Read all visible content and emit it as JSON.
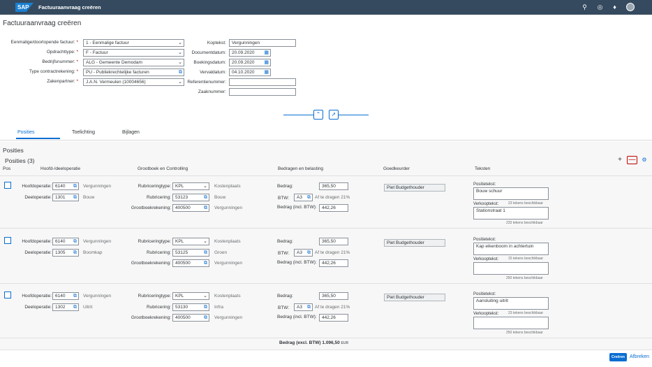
{
  "shell": {
    "logo": "SAP",
    "title": "Factuuraanvraag creëren"
  },
  "page": {
    "title": "Factuuraanvraag creëren"
  },
  "header": {
    "eenmalig_label": "Eenmalige/doorlopende factuur:",
    "eenmalig_value": "1 - Eenmalige factuur",
    "opdrachttype_label": "Opdrachttype:",
    "opdrachttype_value": "F - Factuur",
    "bedrijfsnummer_label": "Bedrijfsnummer:",
    "bedrijfsnummer_value": "ALG - Gemeente Demodam",
    "contract_label": "Type contractrekening:",
    "contract_value": "PU - Publiekrechtelijke facturen",
    "zakenpartner_label": "Zakenpartner:",
    "zakenpartner_value": "J.A.N. Vermeulen (10004656)",
    "koptekst_label": "Koptekst:",
    "koptekst_value": "Vergunningen",
    "documentdatum_label": "Documentdatum:",
    "documentdatum_value": "20.09.2020",
    "boekingsdatum_label": "Boekingsdatum:",
    "boekingsdatum_value": "20.09.2020",
    "vervaldatum_label": "Vervaldatum:",
    "vervaldatum_value": "04.10.2020",
    "referentie_label": "Referentienummer:",
    "referentie_value": "",
    "zaak_label": "Zaaknummer:",
    "zaak_value": ""
  },
  "tabs": [
    "Posities",
    "Toelichting",
    "Bijlagen"
  ],
  "section": {
    "title": "Posities",
    "table_title": "Posities (3)"
  },
  "columns": {
    "pos": "Pos",
    "hoofd": "Hoofd-/deeloperatie",
    "grootboek": "Grootboek en Controlling",
    "bedragen": "Bedragen en belasting",
    "goedkeurder": "Goedkeurder",
    "teksten": "Teksten"
  },
  "labels": {
    "hoofdoperatie": "Hoofdoperatie:",
    "deeloperatie": "Deeloperatie:",
    "rubriceringtype": "Rubriceringtype:",
    "rubricering": "Rubricering:",
    "grootboekrekening": "Grootboekrekening:",
    "bedrag": "Bedrag:",
    "btw": "BTW:",
    "bedrag_incl": "Bedrag (incl. BTW):",
    "positietekst": "Positietekst:",
    "verkooptekst": "Verkooptekst:"
  },
  "rows": [
    {
      "hoofd_code": "6140",
      "hoofd_text": "Vergunningen",
      "deel_code": "1301",
      "deel_text": "Bouw",
      "rubtype": "KPL",
      "rubtype_text": "Kostenplaats",
      "rub": "53123",
      "rub_text": "Bouw",
      "gb": "400500",
      "gb_text": "Vergunningen",
      "bedrag": "365,50",
      "btw": "A3",
      "btw_text": "Af te dragen 21%",
      "incl": "442,26",
      "goedkeurder": "Piet Budgethouder",
      "positietekst": "Bouw schuur",
      "pos_count": "23 tekens beschikbaar",
      "verkooptekst": "Stationstraat 1",
      "verk_count": "233 tekens beschikbaar"
    },
    {
      "hoofd_code": "6140",
      "hoofd_text": "Vergunningen",
      "deel_code": "1305",
      "deel_text": "Boomkap",
      "rubtype": "KPL",
      "rubtype_text": "Kostenplaats",
      "rub": "53125",
      "rub_text": "Groen",
      "gb": "400500",
      "gb_text": "Vergunningen",
      "bedrag": "365,50",
      "btw": "A3",
      "btw_text": "Af te dragen 21%",
      "incl": "442,26",
      "goedkeurder": "Piet Budgethouder",
      "positietekst": "Kap eikenboom in achtertuin",
      "pos_count": "15 tekens beschikbaar",
      "verkooptekst": "",
      "verk_count": "250 tekens beschikbaar"
    },
    {
      "hoofd_code": "6140",
      "hoofd_text": "Vergunningen",
      "deel_code": "1302",
      "deel_text": "Uitrit",
      "rubtype": "KPL",
      "rubtype_text": "Kostenplaats",
      "rub": "53130",
      "rub_text": "Infra",
      "gb": "400500",
      "gb_text": "Vergunningen",
      "bedrag": "365,50",
      "btw": "A3",
      "btw_text": "Af te dragen 21%",
      "incl": "442,26",
      "goedkeurder": "Piet Budgethouder",
      "positietekst": "Aansluiting uitrit",
      "pos_count": "23 tekens beschikbaar",
      "verkooptekst": "",
      "verk_count": "250 tekens beschikbaar"
    }
  ],
  "total": {
    "label": "Bedrag (excl. BTW) 1.096,50",
    "currency": "EUR"
  },
  "footer": {
    "create": "Creëren",
    "cancel": "Afbreken"
  }
}
